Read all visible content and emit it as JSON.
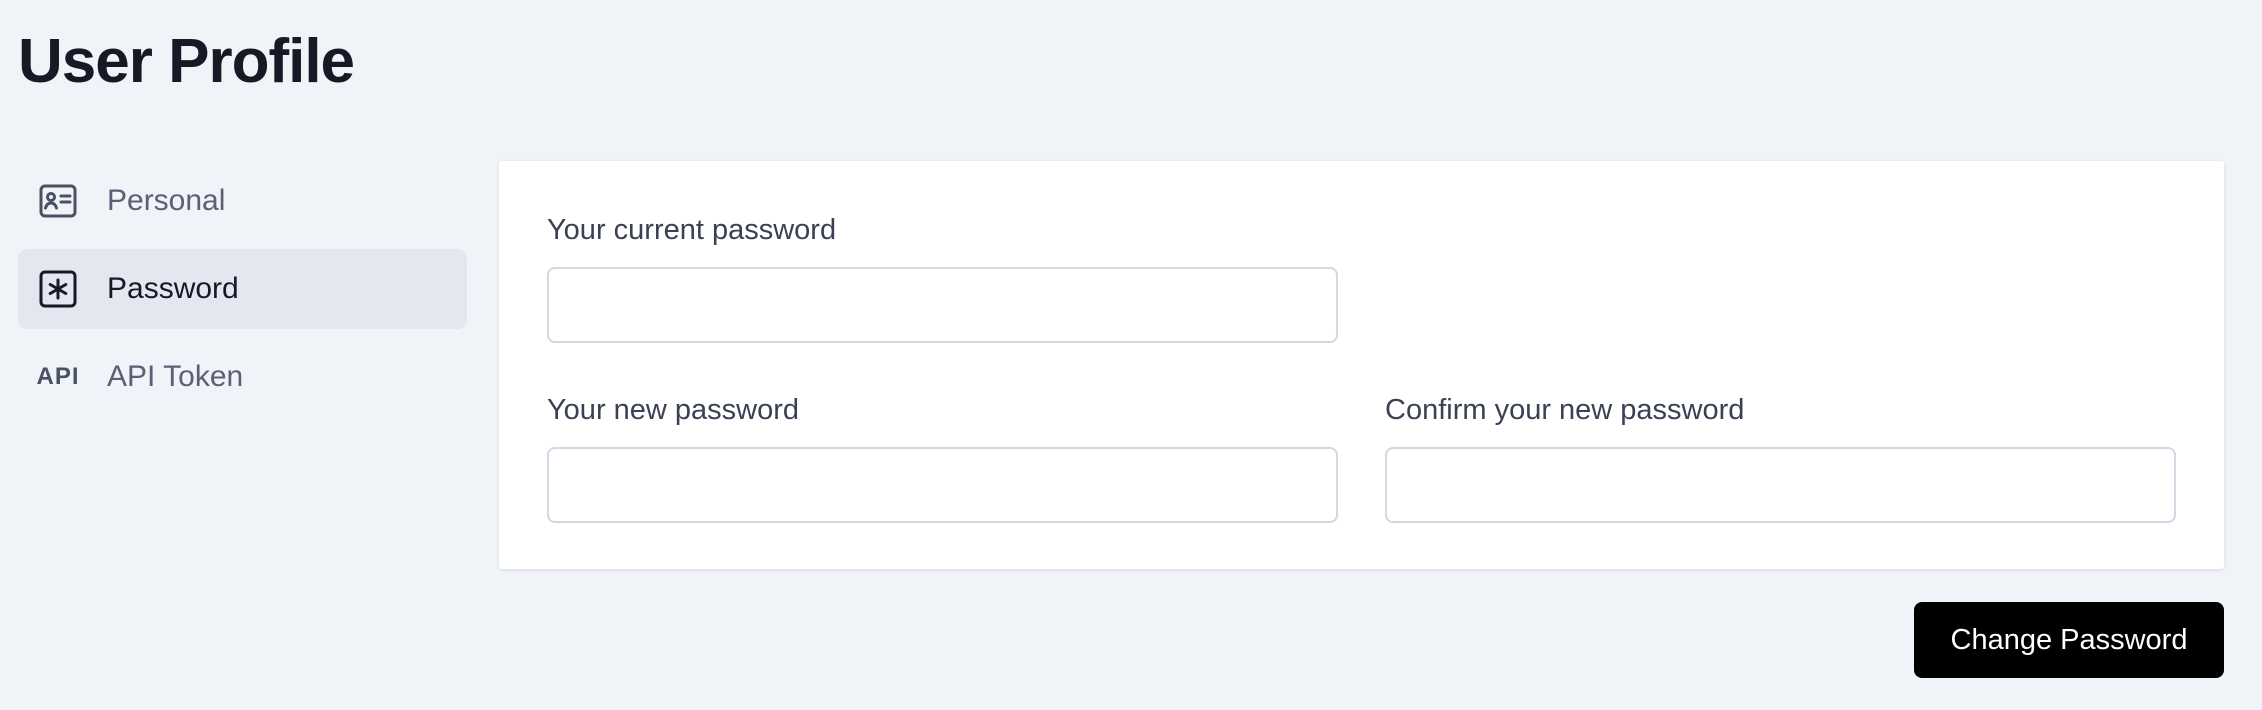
{
  "header": {
    "title": "User Profile"
  },
  "sidebar": {
    "items": [
      {
        "label": "Personal",
        "icon": "id-card-icon",
        "active": false
      },
      {
        "label": "Password",
        "icon": "asterisk-box-icon",
        "active": true
      },
      {
        "label": "API Token",
        "icon": "api-icon",
        "icon_text": "API",
        "active": false
      }
    ]
  },
  "form": {
    "current_password": {
      "label": "Your current password",
      "value": "",
      "placeholder": ""
    },
    "new_password": {
      "label": "Your new password",
      "value": "",
      "placeholder": ""
    },
    "confirm_password": {
      "label": "Confirm your new password",
      "value": "",
      "placeholder": ""
    }
  },
  "actions": {
    "submit_label": "Change Password"
  },
  "colors": {
    "background": "#f0f3f8",
    "active_item": "#e2e7f0",
    "button": "#000000",
    "card": "#ffffff"
  }
}
